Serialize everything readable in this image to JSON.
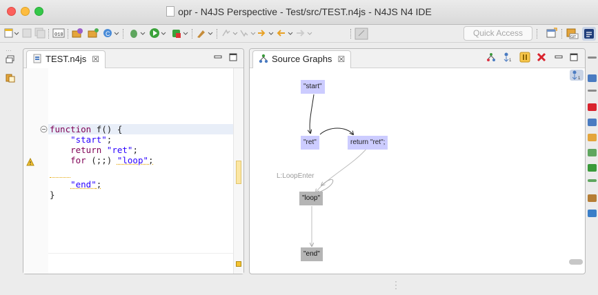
{
  "window": {
    "title": "opr - N4JS Perspective - Test/src/TEST.n4js - N4JS N4 IDE"
  },
  "toolbar": {
    "quick_access_placeholder": "Quick Access"
  },
  "editor": {
    "tab_label": "TEST.n4js",
    "tab_close": "☒",
    "code_lines": [
      "function f() {",
      "    \"start\";",
      "    return \"ret\";",
      "    for (;;) \"loop\";",
      "",
      "    \"end\";",
      "}"
    ]
  },
  "graph": {
    "tab_label": "Source Graphs",
    "tab_close": "☒",
    "nodes": {
      "start": "\"start\"",
      "ret": "\"ret\"",
      "return_ret": "return \"ret\";",
      "loop": "\"loop\"",
      "end": "\"end\""
    },
    "edge_label": "L:LoopEnter"
  },
  "colors": {
    "node_blue": "#ccccff",
    "node_gray": "#b5b5b5",
    "keyword": "#7f0055",
    "string": "#2a00ff"
  }
}
